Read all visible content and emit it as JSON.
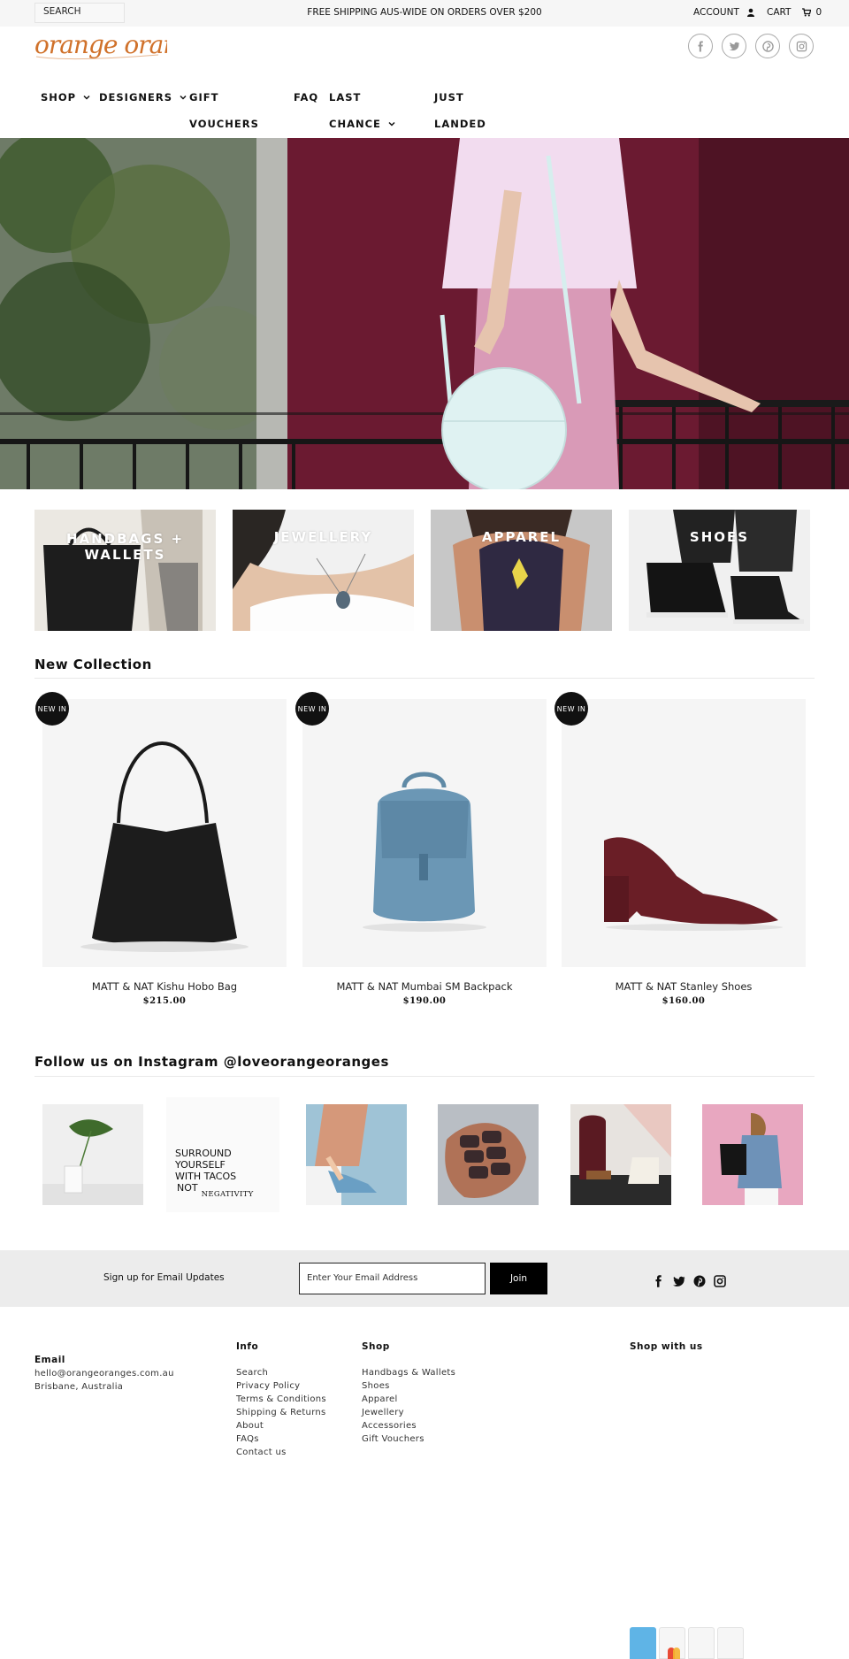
{
  "topbar": {
    "search_label": "SEARCH",
    "promo": "FREE SHIPPING AUS-WIDE ON ORDERS OVER $200",
    "account_label": "ACCOUNT",
    "cart_label": "CART",
    "cart_count": "0"
  },
  "brand": {
    "logo_text": "orange oranges",
    "logo_color": "#d0712a"
  },
  "social_icons": [
    "facebook-icon",
    "twitter-icon",
    "pinterest-icon",
    "instagram-icon"
  ],
  "nav": {
    "shop": "SHOP",
    "designers": "DESIGNERS",
    "gift_line1": "GIFT",
    "gift_line2": "VOUCHERS",
    "faq": "FAQ",
    "last_line1": "LAST",
    "last_line2": "CHANCE",
    "just_line1": "JUST",
    "just_line2": "LANDED"
  },
  "categories": [
    {
      "line1": "HANDBAGS +",
      "line2": "WALLETS"
    },
    {
      "line1": "JEWELLERY",
      "line2": ""
    },
    {
      "line1": "APPAREL",
      "line2": ""
    },
    {
      "line1": "SHOES",
      "line2": ""
    }
  ],
  "new_collection": {
    "title": "New Collection",
    "badge": "NEW IN",
    "products": [
      {
        "name": "MATT & NAT Kishu Hobo Bag",
        "price": "$215.00"
      },
      {
        "name": "MATT & NAT Mumbai SM Backpack",
        "price": "$190.00"
      },
      {
        "name": "MATT & NAT Stanley Shoes",
        "price": "$160.00"
      }
    ]
  },
  "instagram": {
    "title": "Follow us on Instagram @loveorangeoranges",
    "quote_lines": [
      "SURROUND",
      "YOURSELF",
      "WITH TACOS",
      "NOT"
    ],
    "quote_tail": "NEGATIVITY"
  },
  "newsletter": {
    "label": "Sign up for Email Updates",
    "placeholder": "Enter Your Email Address",
    "button": "Join"
  },
  "footer": {
    "email_heading": "Email",
    "email": "hello@orangeoranges.com.au",
    "location": "Brisbane, Australia",
    "info_heading": "Info",
    "info_links": [
      "Search",
      "Privacy Policy",
      "Terms & Conditions",
      "Shipping & Returns",
      "About",
      "FAQs",
      "Contact us"
    ],
    "shop_heading": "Shop",
    "shop_links": [
      "Handbags & Wallets",
      "Shoes",
      "Apparel",
      "Jewellery",
      "Accessories",
      "Gift Vouchers"
    ],
    "shop_with_us_heading": "Shop with us"
  }
}
